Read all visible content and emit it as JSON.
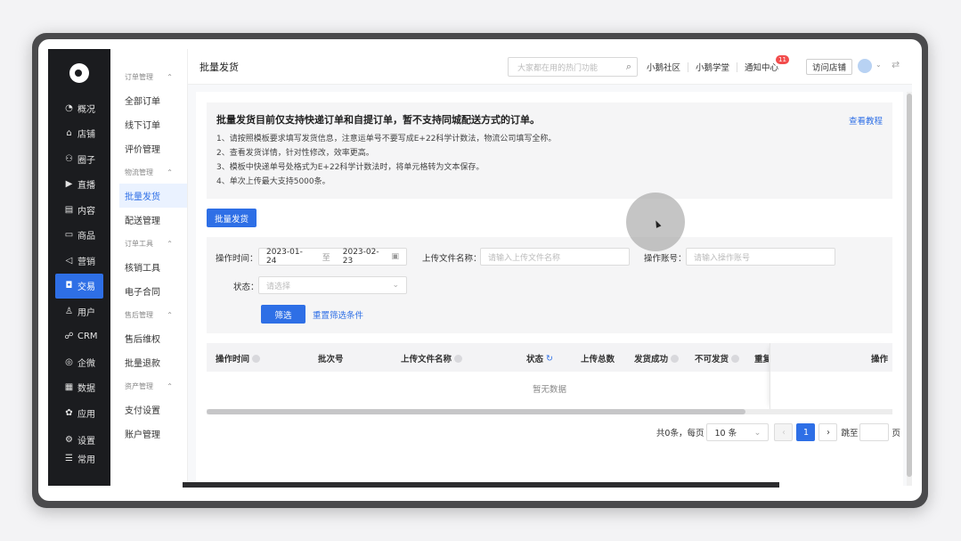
{
  "nav": {
    "items": [
      {
        "icon": "◔",
        "icon_name": "overview-icon",
        "label": "概况"
      },
      {
        "icon": "⌂",
        "icon_name": "store-icon",
        "label": "店铺"
      },
      {
        "icon": "⚇",
        "icon_name": "circle-icon",
        "label": "圈子"
      },
      {
        "icon": "▶",
        "icon_name": "live-icon",
        "label": "直播"
      },
      {
        "icon": "▤",
        "icon_name": "content-icon",
        "label": "内容"
      },
      {
        "icon": "▭",
        "icon_name": "goods-icon",
        "label": "商品"
      },
      {
        "icon": "◁",
        "icon_name": "marketing-icon",
        "label": "营销"
      },
      {
        "icon": "◘",
        "icon_name": "trade-icon",
        "label": "交易"
      },
      {
        "icon": "♙",
        "icon_name": "user-icon",
        "label": "用户"
      },
      {
        "icon": "☍",
        "icon_name": "crm-icon",
        "label": "CRM"
      },
      {
        "icon": "◎",
        "icon_name": "wecom-icon",
        "label": "企微"
      },
      {
        "icon": "▦",
        "icon_name": "data-icon",
        "label": "数据"
      },
      {
        "icon": "✿",
        "icon_name": "apps-icon",
        "label": "应用"
      }
    ],
    "bottom": [
      {
        "icon": "⚙",
        "icon_name": "settings-icon",
        "label": "设置"
      },
      {
        "icon": "☰",
        "icon_name": "common-icon",
        "label": "常用"
      }
    ]
  },
  "sub": {
    "groups": [
      {
        "title": "订单管理",
        "items": [
          "全部订单",
          "线下订单",
          "评价管理"
        ]
      },
      {
        "title": "物流管理",
        "items": [
          "批量发货",
          "配送管理"
        ]
      },
      {
        "title": "订单工具",
        "items": [
          "核销工具",
          "电子合同"
        ]
      },
      {
        "title": "售后管理",
        "items": [
          "售后维权",
          "批量退款"
        ]
      },
      {
        "title": "资产管理",
        "items": [
          "支付设置",
          "账户管理"
        ]
      }
    ]
  },
  "topbar": {
    "title": "批量发货",
    "search_placeholder": "大家都在用的热门功能",
    "links": [
      "小鹅社区",
      "小鹅学堂",
      "通知中心"
    ],
    "notify_badge": "11",
    "visit_store": "访问店铺"
  },
  "notice": {
    "title": "批量发货目前仅支持快递订单和自提订单，暂不支持同城配送方式的订单。",
    "tutorial": "查看教程",
    "lines": [
      "1、请按照模板要求填写发货信息，注意运单号不要写成E+22科学计数法，物流公司填写全称。",
      "2、查看发货详情，针对性修改，效率更高。",
      "3、模板中快递单号处格式为E+22科学计数法时，将单元格转为文本保存。",
      "4、单次上传最大支持5000条。"
    ]
  },
  "batch_button": "批量发货",
  "filter": {
    "time_label": "操作时间：",
    "date_start": "2023-01-24",
    "date_sep": "至",
    "date_end": "2023-02-23",
    "file_label": "上传文件名称：",
    "file_placeholder": "请输入上传文件名称",
    "account_label": "操作账号：",
    "account_placeholder": "请输入操作账号",
    "status_label": "状态：",
    "status_placeholder": "请选择",
    "filter_button": "筛选",
    "reset_link": "重置筛选条件"
  },
  "table": {
    "columns": [
      "操作时间",
      "批次号",
      "上传文件名称",
      "状态",
      "上传总数",
      "发货成功",
      "不可发货",
      "重复",
      "操作"
    ],
    "empty_text": "暂无数据"
  },
  "pagination": {
    "total": "共0条，每页",
    "page_size": "10 条",
    "current_page": "1",
    "jump_label": "跳至",
    "page_unit": "页"
  },
  "colors": {
    "accent": "#2e6fe6",
    "nav_bg": "#1b1c1f",
    "badge": "#f24c4c"
  }
}
